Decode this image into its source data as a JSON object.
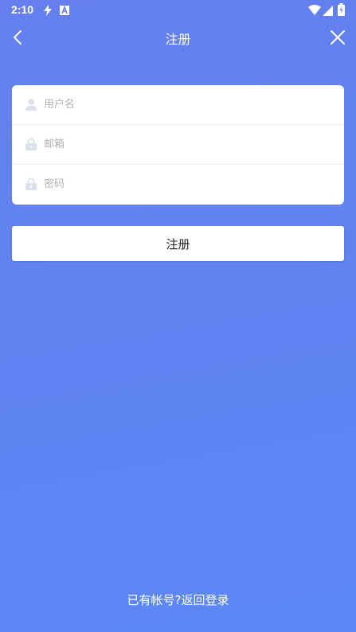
{
  "status_bar": {
    "time": "2:10"
  },
  "nav": {
    "title": "注册"
  },
  "form": {
    "username_placeholder": "用户名",
    "email_placeholder": "邮箱",
    "password_placeholder": "密码"
  },
  "submit_label": "注册",
  "login_link": "已有帐号?返回登录",
  "colors": {
    "background": "#6283f0",
    "card": "#ffffff",
    "placeholder": "#b3b3b3",
    "icon": "#dde1ec"
  },
  "icons": [
    "flash-icon",
    "a-icon",
    "wifi-icon",
    "signal-icon",
    "battery-icon",
    "back-icon",
    "close-icon",
    "user-icon",
    "lock-icon"
  ]
}
